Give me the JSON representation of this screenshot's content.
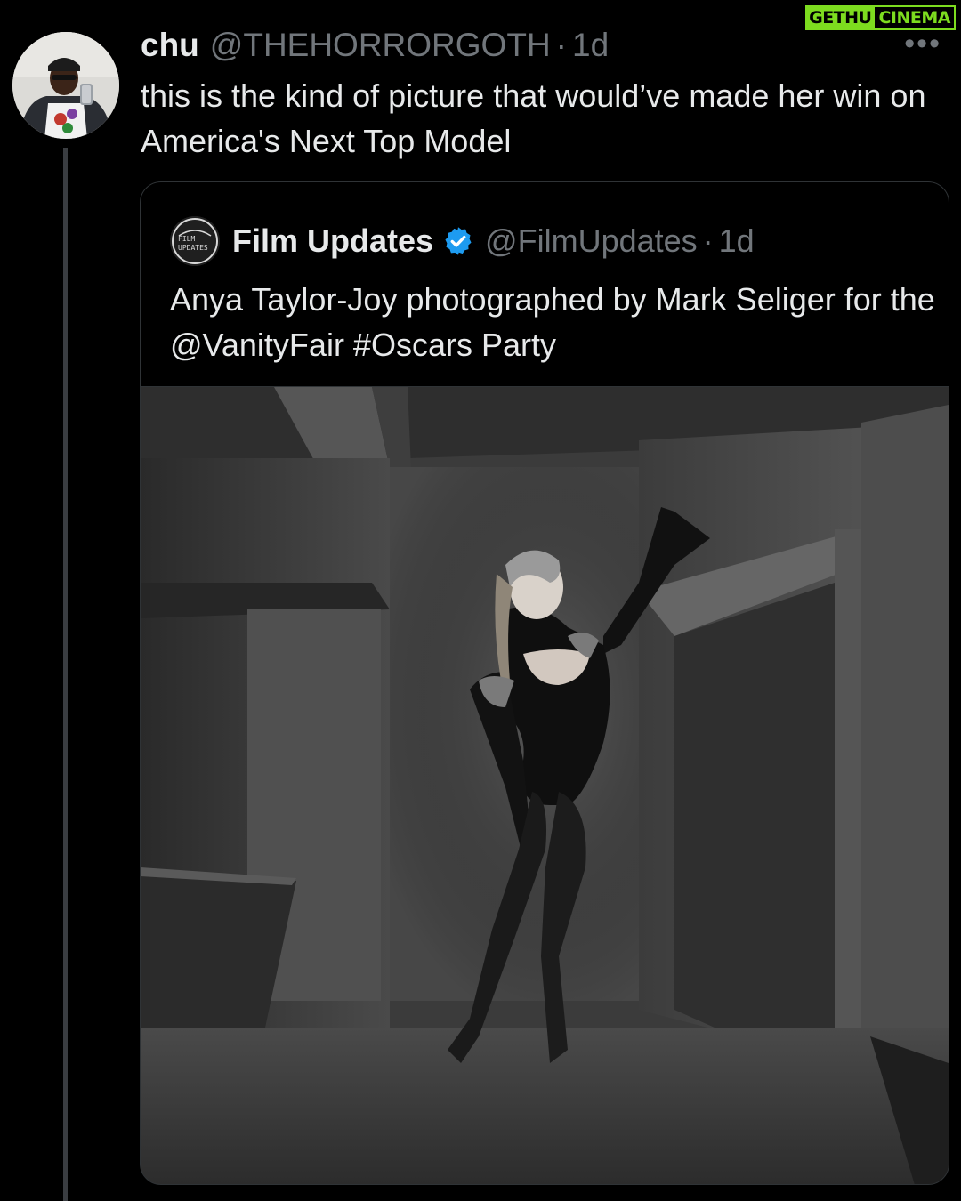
{
  "watermark": {
    "part1": "GETHU",
    "part2": "CINEMA"
  },
  "reply": {
    "name": "chu",
    "handle": "@THEHORRORGOTH",
    "separator": "·",
    "time": "1d",
    "text": "this is the kind of picture that would’ve made her win on America's Next Top Model",
    "more": "•••"
  },
  "quote": {
    "logo_text_1": "FILM",
    "logo_text_2": "UPDATES",
    "name": "Film Updates",
    "handle": "@FilmUpdates",
    "separator": "·",
    "time": "1d",
    "text": "Anya Taylor-Joy photographed by Mark Seliger for the @VanityFair #Oscars Party"
  },
  "colors": {
    "background": "#000000",
    "text": "#e7e9ea",
    "muted": "#71767b",
    "verified": "#1d9bf0",
    "watermark": "#7ddc1f"
  }
}
